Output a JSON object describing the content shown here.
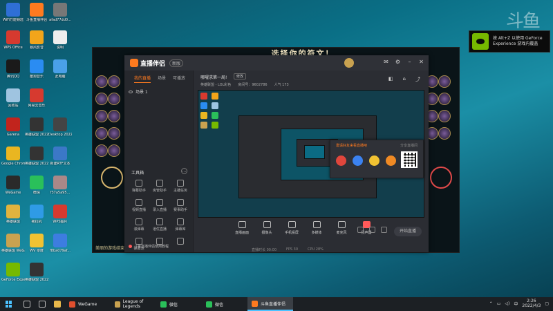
{
  "desktop": {
    "icons": [
      {
        "label": "WiFi万能钥匙",
        "color": "#2f6fd6"
      },
      {
        "label": "斗鱼直播伴侣",
        "color": "#ff7a1f"
      },
      {
        "label": "afad77dd0...",
        "color": "#777"
      },
      {
        "label": "WPS Office",
        "color": "#d63a2f"
      },
      {
        "label": "暴风影音",
        "color": "#f2a51a"
      },
      {
        "label": "说明",
        "color": "#eee"
      },
      {
        "label": "腾讯QQ",
        "color": "#1a1a1a"
      },
      {
        "label": "酷狗音乐",
        "color": "#2a8cf2"
      },
      {
        "label": "此电脑",
        "color": "#4aa0e8"
      },
      {
        "label": "回收站",
        "color": "#9fc4e0"
      },
      {
        "label": "网易云音乐",
        "color": "#d63a2f"
      },
      {
        "label": "Garena",
        "color": "#c1241d"
      },
      {
        "label": "英雄联盟 2022.09.0...",
        "color": "#333"
      },
      {
        "label": "Desktop 2022.09.0",
        "color": "#444"
      },
      {
        "label": "Google Chrome",
        "color": "#e9b621"
      },
      {
        "label": "英雄联盟 2022.09.0...",
        "color": "#333"
      },
      {
        "label": "新建RTF文本",
        "color": "#3b78c7"
      },
      {
        "label": "WeGame",
        "color": "#2a2a2a"
      },
      {
        "label": "微信",
        "color": "#2ac05a"
      },
      {
        "label": "f37a5a95...",
        "color": "#a88"
      },
      {
        "label": "英雄联盟",
        "color": "#e0b33e"
      },
      {
        "label": "拖拉机",
        "color": "#2f9be6"
      },
      {
        "label": "WPS图片",
        "color": "#d63a2f"
      },
      {
        "label": "英雄联盟 WeGame版",
        "color": "#c9a250"
      },
      {
        "label": "WV 零度",
        "color": "#f1c232"
      },
      {
        "label": "f8ba079af...",
        "color": "#3d7de0"
      },
      {
        "label": "GeForce Experience",
        "color": "#76b900"
      },
      {
        "label": "英雄联盟 2022.09.2...",
        "color": "#333"
      }
    ]
  },
  "watermark": {
    "logo": "斗鱼",
    "room_number": "9602786"
  },
  "geforce_toast": {
    "line1": "按 Alt+Z 以使用 GeForce",
    "line2": "Experience 游戏内覆盖"
  },
  "game": {
    "title": "选择你的符文！",
    "chat_line": "美丽的游戏结束后，请不要离开..."
  },
  "douyu": {
    "app_name": "直播伴侣",
    "version": "新版",
    "tabs": [
      "我的直播",
      "场景",
      "可播放"
    ],
    "scene_label": "场景 1",
    "tools_title": "工具箱",
    "tools": [
      "弹幕助手",
      "房管助手",
      "主播任务",
      "视频直播",
      "录入直播",
      "赛事助手",
      "滚弹幕",
      "道优直播",
      "弹幕库",
      "弹幕池",
      "",
      ""
    ],
    "left_footer": "斗鱼直播伴侣使用教程",
    "room_title": "哪曜求第一局!",
    "room_edit": "修改",
    "room_meta": [
      "英雄联盟 - LOL彩色",
      "房间号：9602786",
      "人气 173"
    ],
    "share": {
      "header": "邀请好友来看直播吧",
      "aside": "分享直播间",
      "qr_label": ""
    },
    "bottom_controls": [
      "直播画面",
      "摄像头",
      "手机投屏",
      "多媒体",
      "麦克风",
      "扬声器"
    ],
    "start_button": "开始直播",
    "status": [
      "直播时长 00:00",
      "FPS 30",
      "CPU 28%"
    ]
  },
  "taskbar": {
    "tasks": [
      {
        "label": "WeGame",
        "color": "#e04f2e",
        "active": false
      },
      {
        "label": "League of Legends",
        "color": "#c9a250",
        "active": false
      },
      {
        "label": "微信",
        "color": "#2ac05a",
        "active": false
      },
      {
        "label": "微信",
        "color": "#2ac05a",
        "active": false
      },
      {
        "label": "斗鱼直播伴侣",
        "color": "#ff7a1f",
        "active": true
      }
    ],
    "time": "2:26",
    "date": "2022/4/3",
    "lang": "中"
  }
}
